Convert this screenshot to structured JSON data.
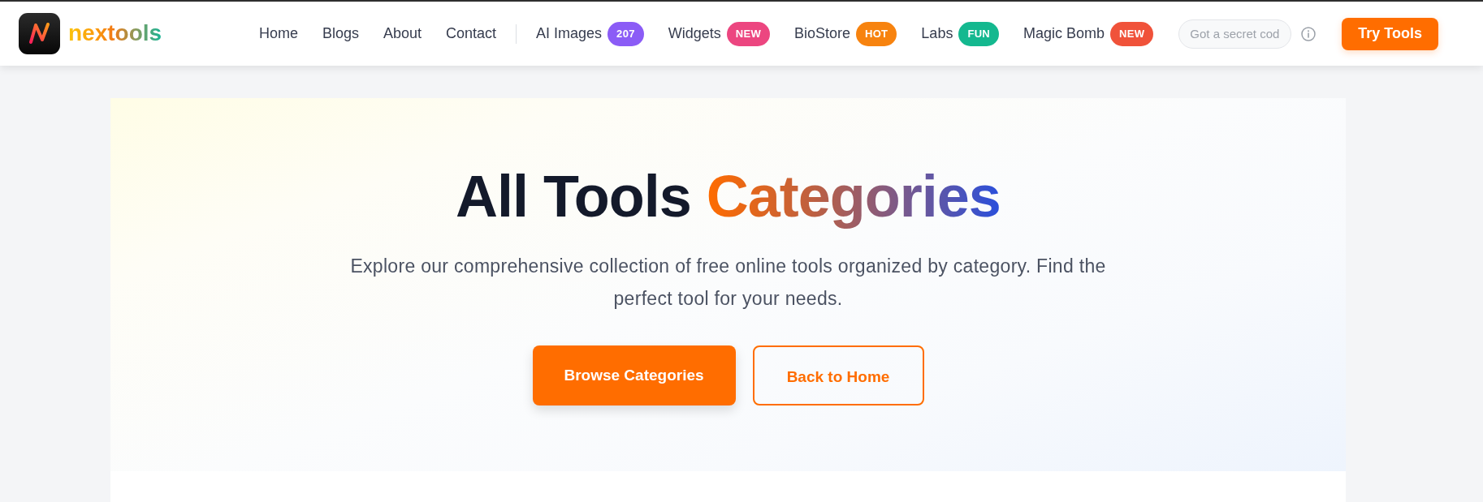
{
  "header": {
    "logo": {
      "text": "nextools"
    },
    "nav_links": [
      {
        "label": "Home"
      },
      {
        "label": "Blogs"
      },
      {
        "label": "About"
      },
      {
        "label": "Contact"
      }
    ],
    "featured_links": [
      {
        "label": "AI Images",
        "badge": {
          "text": "207",
          "color": "#8b5cf6"
        }
      },
      {
        "label": "Widgets",
        "badge": {
          "text": "NEW",
          "color": "#ec4680"
        }
      },
      {
        "label": "BioStore",
        "badge": {
          "text": "HOT",
          "color": "#f7830f"
        }
      },
      {
        "label": "Labs",
        "badge": {
          "text": "FUN",
          "color": "#14b88f"
        }
      },
      {
        "label": "Magic Bomb",
        "badge": {
          "text": "NEW",
          "color": "#f0523a"
        }
      }
    ],
    "secret_code": {
      "placeholder": "Got a secret cod"
    },
    "cta_button": {
      "label": "Try Tools"
    }
  },
  "hero": {
    "title": "All Tools",
    "title_highlight": "Categories",
    "subtitle": "Explore our comprehensive collection of free online tools organized by category. Find the perfect tool for your needs.",
    "buttons": [
      {
        "label": "Browse Categories",
        "kind": "primary"
      },
      {
        "label": "Back to Home",
        "kind": "outline"
      }
    ]
  }
}
